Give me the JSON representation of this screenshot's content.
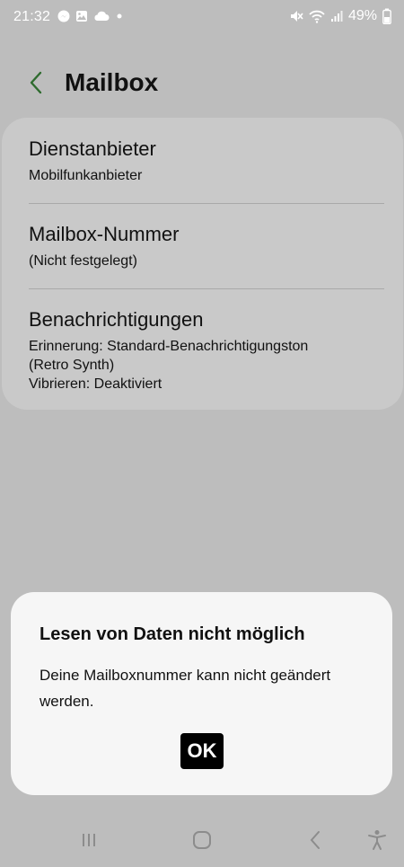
{
  "status_bar": {
    "time": "21:32",
    "battery_percent": "49%",
    "left_icons": [
      "messenger-icon",
      "gallery-icon",
      "cloud-icon",
      "dot-icon"
    ],
    "right_icons": [
      "mute-icon",
      "wifi-icon",
      "signal-icon",
      "battery-icon"
    ]
  },
  "header": {
    "title": "Mailbox",
    "back_icon": "chevron-left-icon",
    "back_color": "#2e6b2e"
  },
  "settings": {
    "items": [
      {
        "title": "Dienstanbieter",
        "subtitle_lines": [
          "Mobilfunkanbieter"
        ]
      },
      {
        "title": "Mailbox-Nummer",
        "subtitle_lines": [
          "(Nicht festgelegt)"
        ]
      },
      {
        "title": "Benachrichtigungen",
        "subtitle_lines": [
          "Erinnerung: Standard-Benachrichtigungston",
          "(Retro Synth)",
          "Vibrieren: Deaktiviert"
        ]
      }
    ]
  },
  "dialog": {
    "title": "Lesen von Daten nicht möglich",
    "message": "Deine Mailboxnummer kann nicht geändert werden.",
    "ok_label": "OK"
  },
  "nav_bar": {
    "icons": [
      "recent-apps-icon",
      "home-icon",
      "back-icon",
      "accessibility-icon"
    ]
  }
}
